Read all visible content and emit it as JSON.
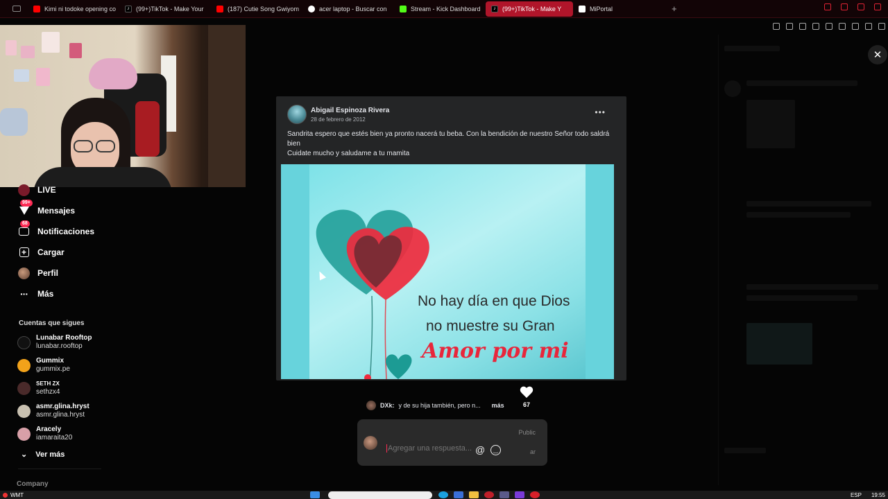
{
  "browser": {
    "tabs": [
      {
        "label": "Kimi ni todoke opening co",
        "icon": "youtube-icon"
      },
      {
        "label": "(99+)TikTok - Make Your",
        "icon": "tiktok-icon"
      },
      {
        "label": "(187) Cutie Song Gwiyom",
        "icon": "youtube-icon"
      },
      {
        "label": "acer laptop - Buscar con",
        "icon": "google-icon"
      },
      {
        "label": "Stream - Kick Dashboard",
        "icon": "kick-icon"
      },
      {
        "label": "(99+)TikTok - Make Y",
        "icon": "tiktok-icon",
        "active": true
      },
      {
        "label": "MiPortal",
        "icon": "miportal-icon"
      }
    ],
    "new_tab": "+"
  },
  "sidebar": {
    "nav": [
      {
        "label": "LIVE"
      },
      {
        "label": "Mensajes",
        "badge": "99+"
      },
      {
        "label": "Notificaciones",
        "badge": "68"
      },
      {
        "label": "Cargar"
      },
      {
        "label": "Perfil"
      },
      {
        "label": "Más"
      }
    ],
    "following_title": "Cuentas que sigues",
    "following": [
      {
        "name": "Lunabar Rooftop",
        "handle": "lunabar.rooftop",
        "color": "#111111"
      },
      {
        "name": "Gummix",
        "handle": "gummix.pe",
        "color": "#f2a21a"
      },
      {
        "name": "SETH ZX",
        "handle": "sethzx4",
        "color": "#4a2a2a"
      },
      {
        "name": "asmr.glina.hryst",
        "handle": "asmr.glina.hryst",
        "color": "#c8c0b0"
      },
      {
        "name": "Aracely",
        "handle": "iamaraita20",
        "color": "#d8a0a8"
      }
    ],
    "see_more": "Ver más",
    "company": "Company"
  },
  "post": {
    "author": "Abigail Espinoza Rivera",
    "date": "28 de febrero de 2012",
    "more": "•••",
    "text_line1": "Sandrita espero que estés bien ya pronto nacerá tu beba. Con la bendición de nuestro Señor todo saldrá bien",
    "text_line2": "Cuidate mucho y saludame a tu mamita",
    "image_line1": "No hay día en que Dios",
    "image_line2": "no muestre su Gran",
    "image_line3": "Amor por mi"
  },
  "comment": {
    "user": "DXk:",
    "text": "y de su hija también, pero n...",
    "more": "más",
    "likes": "67"
  },
  "reply": {
    "public_label": "Public",
    "placeholder": "Agregar una respuesta...",
    "at": "@",
    "suffix": "ar"
  },
  "taskbar": {
    "left_label": "WMT",
    "lang": "ESP",
    "time": "19:55"
  },
  "colors": {
    "accent": "#fe2c55",
    "tab_active": "#b0152a",
    "post_bg": "#242526"
  }
}
